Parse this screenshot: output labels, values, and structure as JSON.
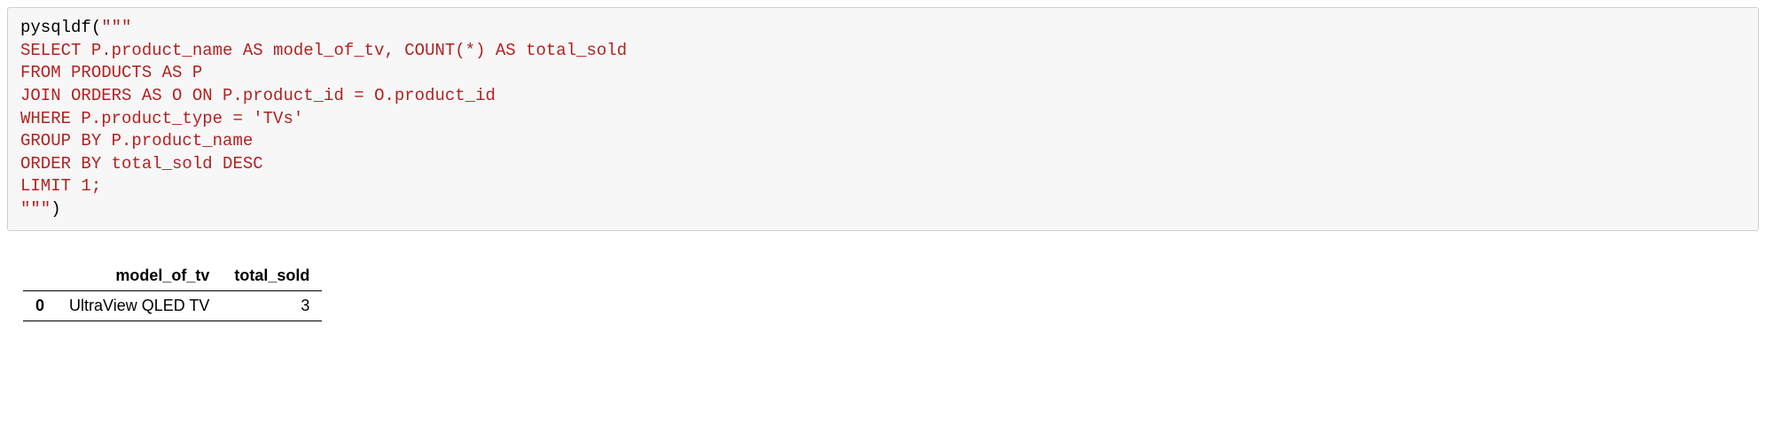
{
  "code": {
    "call_open": "pysqldf(",
    "triple_open": "\"\"\"",
    "sql_lines": [
      "SELECT P.product_name AS model_of_tv, COUNT(*) AS total_sold",
      "FROM PRODUCTS AS P",
      "JOIN ORDERS AS O ON P.product_id = O.product_id",
      "WHERE P.product_type = 'TVs'",
      "GROUP BY P.product_name",
      "ORDER BY total_sold DESC",
      "LIMIT 1;"
    ],
    "triple_close": "\"\"\"",
    "call_close": ")"
  },
  "chart_data": {
    "type": "table",
    "columns": [
      "model_of_tv",
      "total_sold"
    ],
    "index": [
      "0"
    ],
    "rows": [
      {
        "model_of_tv": "UltraView QLED TV",
        "total_sold": 3
      }
    ]
  }
}
